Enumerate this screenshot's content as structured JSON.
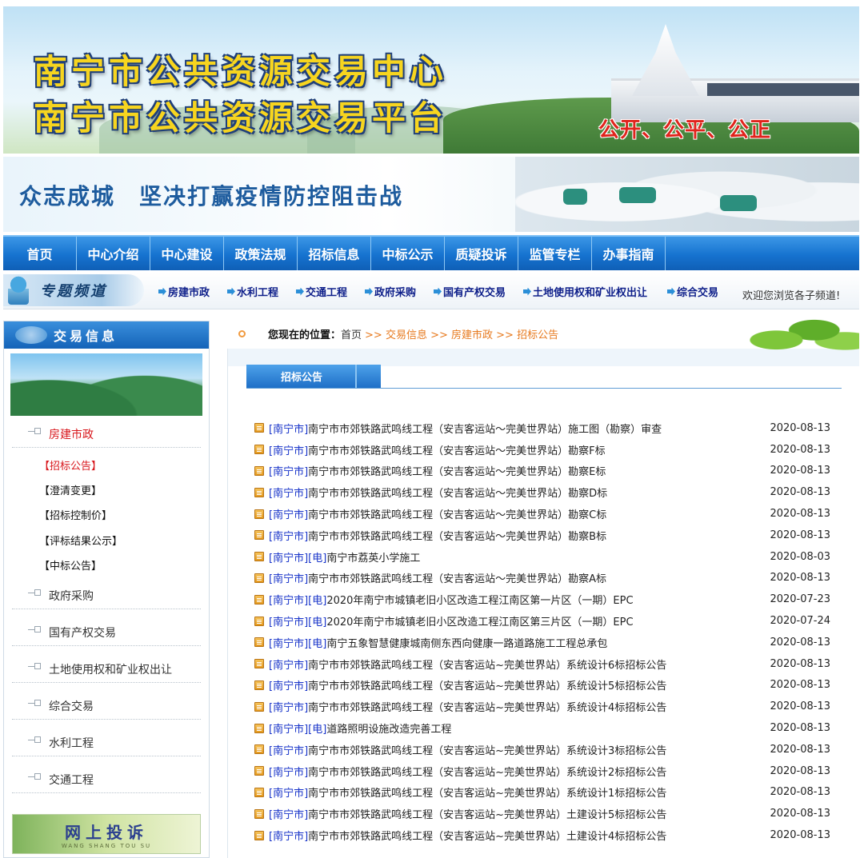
{
  "header": {
    "title_line1": "南宁市公共资源交易中心",
    "title_line2": "南宁市公共资源交易平台",
    "slogan": "公开、公平、公正"
  },
  "campaign": {
    "text": "众志成城　坚决打赢疫情防控阻击战"
  },
  "nav": {
    "items": [
      "首页",
      "中心介绍",
      "中心建设",
      "政策法规",
      "招标信息",
      "中标公示",
      "质疑投诉",
      "监管专栏",
      "办事指南"
    ]
  },
  "topics": {
    "title": "专题频道",
    "links": [
      "房建市政",
      "水利工程",
      "交通工程",
      "政府采购",
      "国有产权交易",
      "土地使用权和矿业权出让",
      "综合交易"
    ],
    "welcome": "欢迎您浏览各子频道!"
  },
  "sidebar": {
    "title": "交易信息",
    "categories": [
      "房建市政",
      "政府采购",
      "国有产权交易",
      "土地使用权和矿业权出让",
      "综合交易",
      "水利工程",
      "交通工程"
    ],
    "subitems": [
      "【招标公告】",
      "【澄清变更】",
      "【招标控制价】",
      "【评标结果公示】",
      "【中标公告】"
    ],
    "complaint_title": "网上投诉",
    "complaint_pinyin": "WANG SHANG TOU SU"
  },
  "breadcrumb": {
    "prefix": "您现在的位置：",
    "home": "首页",
    "segments": [
      ">> 交易信息",
      ">> 房建市政",
      ">> 招标公告"
    ]
  },
  "tab": {
    "label": "招标公告"
  },
  "colors": {
    "nav_blue": "#1673d0",
    "active_red": "#d8161b",
    "link_blue": "#1733c9",
    "breadcrumb_orange": "#e77a1f",
    "slogan_red": "#e0231c",
    "title_yellow": "#f7d51f"
  },
  "notices": [
    {
      "tag": "[南宁市]",
      "tag2": "",
      "title": "南宁市市郊铁路武鸣线工程（安吉客运站～完美世界站）施工图（勘察）审查",
      "date": "2020-08-13"
    },
    {
      "tag": "[南宁市]",
      "tag2": "",
      "title": "南宁市市郊铁路武鸣线工程（安吉客运站～完美世界站）勘察F标",
      "date": "2020-08-13"
    },
    {
      "tag": "[南宁市]",
      "tag2": "",
      "title": "南宁市市郊铁路武鸣线工程（安吉客运站～完美世界站）勘察E标",
      "date": "2020-08-13"
    },
    {
      "tag": "[南宁市]",
      "tag2": "",
      "title": "南宁市市郊铁路武鸣线工程（安吉客运站～完美世界站）勘察D标",
      "date": "2020-08-13"
    },
    {
      "tag": "[南宁市]",
      "tag2": "",
      "title": "南宁市市郊铁路武鸣线工程（安吉客运站～完美世界站）勘察C标",
      "date": "2020-08-13"
    },
    {
      "tag": "[南宁市]",
      "tag2": "",
      "title": "南宁市市郊铁路武鸣线工程（安吉客运站～完美世界站）勘察B标",
      "date": "2020-08-13"
    },
    {
      "tag": "[南宁市]",
      "tag2": "[电]",
      "title": "南宁市荔英小学施工",
      "date": "2020-08-03"
    },
    {
      "tag": "[南宁市]",
      "tag2": "",
      "title": "南宁市市郊铁路武鸣线工程（安吉客运站～完美世界站）勘察A标",
      "date": "2020-08-13"
    },
    {
      "tag": "[南宁市]",
      "tag2": "[电]",
      "title": "2020年南宁市城镇老旧小区改造工程江南区第一片区（一期）EPC",
      "date": "2020-07-23"
    },
    {
      "tag": "[南宁市]",
      "tag2": "[电]",
      "title": "2020年南宁市城镇老旧小区改造工程江南区第三片区（一期）EPC",
      "date": "2020-07-24"
    },
    {
      "tag": "[南宁市]",
      "tag2": "[电]",
      "title": "南宁五象智慧健康城南侧东西向健康一路道路施工工程总承包",
      "date": "2020-08-13"
    },
    {
      "tag": "[南宁市]",
      "tag2": "",
      "title": "南宁市市郊铁路武鸣线工程（安吉客运站~完美世界站）系统设计6标招标公告",
      "date": "2020-08-13"
    },
    {
      "tag": "[南宁市]",
      "tag2": "",
      "title": "南宁市市郊铁路武鸣线工程（安吉客运站~完美世界站）系统设计5标招标公告",
      "date": "2020-08-13"
    },
    {
      "tag": "[南宁市]",
      "tag2": "",
      "title": "南宁市市郊铁路武鸣线工程（安吉客运站~完美世界站）系统设计4标招标公告",
      "date": "2020-08-13"
    },
    {
      "tag": "[南宁市]",
      "tag2": "[电]",
      "title": "道路照明设施改造完善工程",
      "date": "2020-08-13"
    },
    {
      "tag": "[南宁市]",
      "tag2": "",
      "title": "南宁市市郊铁路武鸣线工程（安吉客运站~完美世界站）系统设计3标招标公告",
      "date": "2020-08-13"
    },
    {
      "tag": "[南宁市]",
      "tag2": "",
      "title": "南宁市市郊铁路武鸣线工程（安吉客运站~完美世界站）系统设计2标招标公告",
      "date": "2020-08-13"
    },
    {
      "tag": "[南宁市]",
      "tag2": "",
      "title": "南宁市市郊铁路武鸣线工程（安吉客运站~完美世界站）系统设计1标招标公告",
      "date": "2020-08-13"
    },
    {
      "tag": "[南宁市]",
      "tag2": "",
      "title": "南宁市市郊铁路武鸣线工程（安吉客运站~完美世界站）土建设计5标招标公告",
      "date": "2020-08-13"
    },
    {
      "tag": "[南宁市]",
      "tag2": "",
      "title": "南宁市市郊铁路武鸣线工程（安吉客运站~完美世界站）土建设计4标招标公告",
      "date": "2020-08-13"
    }
  ]
}
